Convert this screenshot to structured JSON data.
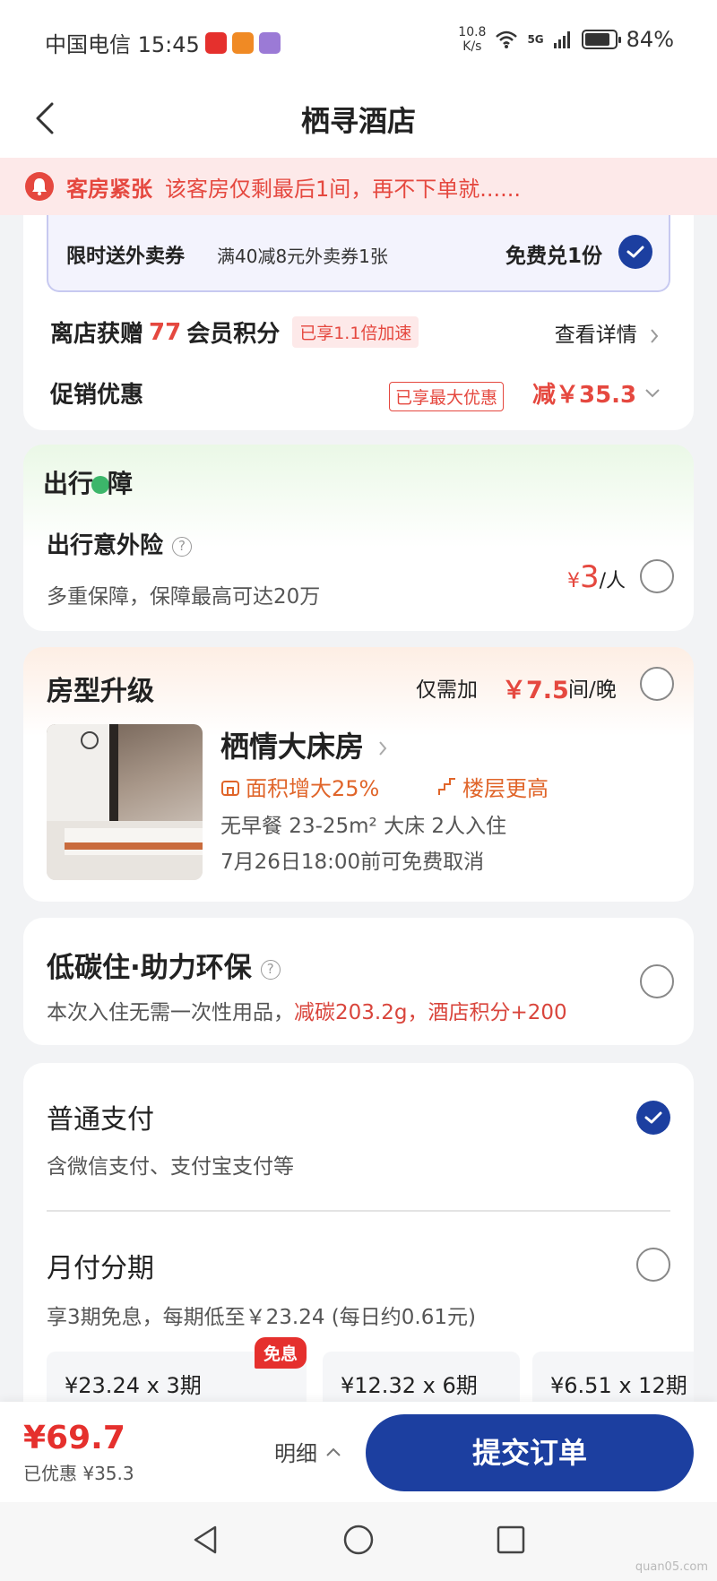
{
  "status_bar": {
    "carrier_time": "中国电信 15:45",
    "net_speed_value": "10.8",
    "net_speed_unit": "K/s",
    "signal": "5G",
    "battery_percent": "84%",
    "battery_level": 0.84,
    "app_icon_colors": [
      "#e5302d",
      "#f08a24",
      "#9b7ad6"
    ]
  },
  "navbar": {
    "title": "栖寻酒店"
  },
  "alert": {
    "title": "客房紧张",
    "text": "该客房仅剩最后1间，再不下单就......"
  },
  "benefits": {
    "coupon_title": "限时送外卖券",
    "coupon_desc": "满40减8元外卖券1张",
    "coupon_action": "免费兑1份",
    "points_prefix": "离店获赠",
    "points_value": "77",
    "points_suffix": "会员积分",
    "points_badge": "已享1.1倍加速",
    "view_details": "查看详情",
    "promo_label": "促销优惠",
    "promo_badge": "已享最大优惠",
    "promo_amount": "减￥35.3"
  },
  "insurance": {
    "section_title_a": "出行",
    "section_title_b": "障",
    "title": "出行意外险",
    "desc": "多重保障，保障最高可达20万",
    "price_symbol": "¥",
    "price": "3",
    "price_unit": "/人"
  },
  "upgrade": {
    "title": "房型升级",
    "need_label": "仅需加",
    "price": "￥7.5",
    "unit": "间/晚",
    "room_name": "栖情大床房",
    "tag_area": "面积增大25%",
    "tag_floor": "楼层更高",
    "info": "无早餐 23-25m² 大床 2人入住",
    "cancel": "7月26日18:00前可免费取消"
  },
  "eco": {
    "title": "低碳住·助力环保",
    "desc_plain": "本次入住无需一次性用品，",
    "desc_highlight": "减碳203.2g，酒店积分+200"
  },
  "payment": {
    "normal_title": "普通支付",
    "normal_desc": "含微信支付、支付宝支付等",
    "installment_title": "月付分期",
    "installment_desc": "享3期免息，每期低至￥23.24 (每日约0.61元)",
    "options": [
      "¥23.24 x 3期",
      "¥12.32 x 6期",
      "¥6.51 x 12期"
    ],
    "free_badge": "免息"
  },
  "bottom": {
    "total": "¥69.7",
    "saved": "已优惠 ¥35.3",
    "detail": "明细",
    "submit": "提交订单"
  },
  "watermark": "quan05.com",
  "colors": {
    "accent_red": "#e5483f",
    "primary_blue": "#1c3fa0",
    "orange": "#e0652a"
  }
}
